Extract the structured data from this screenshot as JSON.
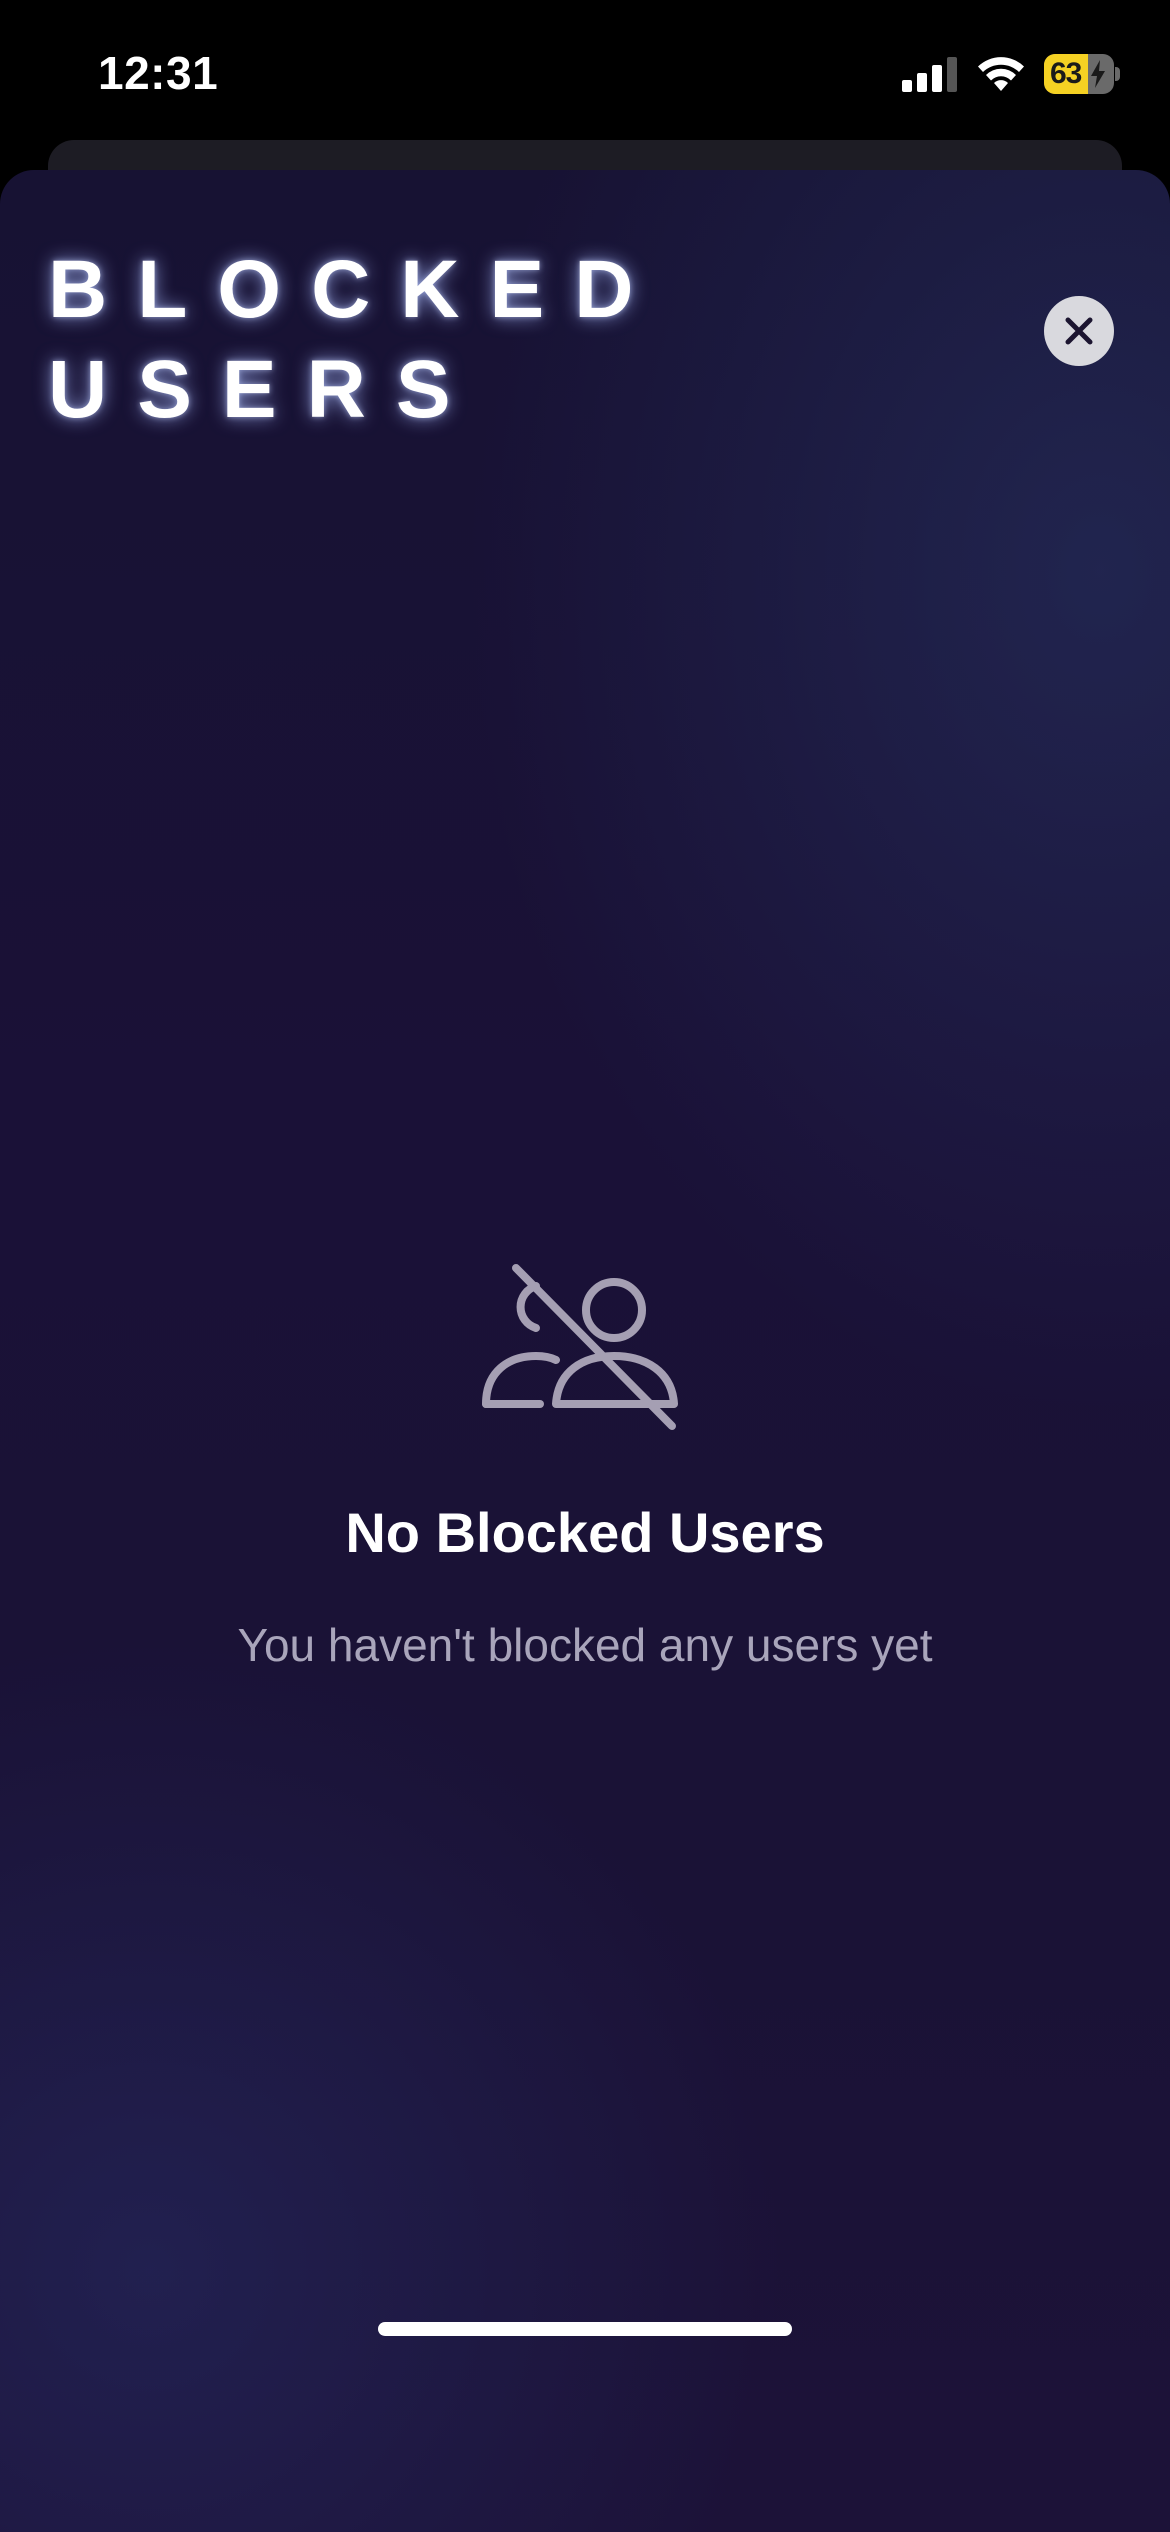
{
  "status_bar": {
    "time": "12:31",
    "battery_level": "63",
    "battery_fraction": 0.63,
    "icons": [
      "cellular-signal-icon",
      "wifi-icon",
      "battery-charging-icon"
    ]
  },
  "sheet": {
    "title_line1": "BLOCKED",
    "title_line2": "USERS",
    "close_icon": "close-icon"
  },
  "empty_state": {
    "icon": "users-slash-icon",
    "title": "No Blocked Users",
    "subtitle": "You haven't blocked any users yet"
  },
  "colors": {
    "background": "#1a1236",
    "accent_battery": "#f5d123",
    "text_primary": "#ffffff",
    "text_secondary": "#a9a5bb",
    "icon_muted": "#a59fb3"
  }
}
